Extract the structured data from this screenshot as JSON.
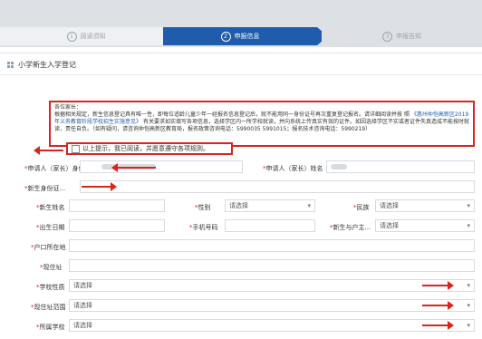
{
  "steps": [
    {
      "num": "1",
      "label": "阅读须知"
    },
    {
      "num": "2",
      "label": "申报信息"
    },
    {
      "num": "3",
      "label": "申报告知"
    }
  ],
  "section_title": "小学新生入学登记",
  "notice": {
    "greeting": "各位家长：",
    "line1": "根据相关规定，新生信息登记具有唯一性，即每位适龄儿童少年一经报名信息登记后，就不能用同一身份证号再次重复登记报名。请详细阅读并按",
    "line2_prefix": "照",
    "link_text": "《惠州仲恺高新区2019年义务教育阶段学校招生实施意见》",
    "line2_suffix": "有关要求如实填写各项信息，选择学区内一所学校就读，并向系统上传真实有效的证件。如因选择学区不实或者证件失真造成不能按时就读，责任自负。（如有疑问，请咨询仲恺高新区教育局，报名政策咨询电话：5990035",
    "line3": "5991015；报名技术咨询电话：5990219）"
  },
  "agree_label": "以上提示，我已阅读，并愿意遵守各项规则。",
  "form": {
    "applicant_id_label": "申请人（家长）身份...",
    "applicant_name_label": "申请人（家长）姓名",
    "student_id_label": "新生身份证...",
    "student_name_label": "新生姓名",
    "gender_label": "性别",
    "ethnicity_label": "民族",
    "birth_label": "出生日期",
    "phone_label": "手机号码",
    "relation_label": "新生与户主...",
    "household_label": "户口所在地",
    "address_label": "现住址",
    "school_type_label": "学校性质",
    "district_label": "现住址范围",
    "school_label": "所属学校",
    "placeholder_select": "请选择"
  },
  "colors": {
    "active_step": "#1f5cab",
    "annotation_red": "#d9251c"
  }
}
